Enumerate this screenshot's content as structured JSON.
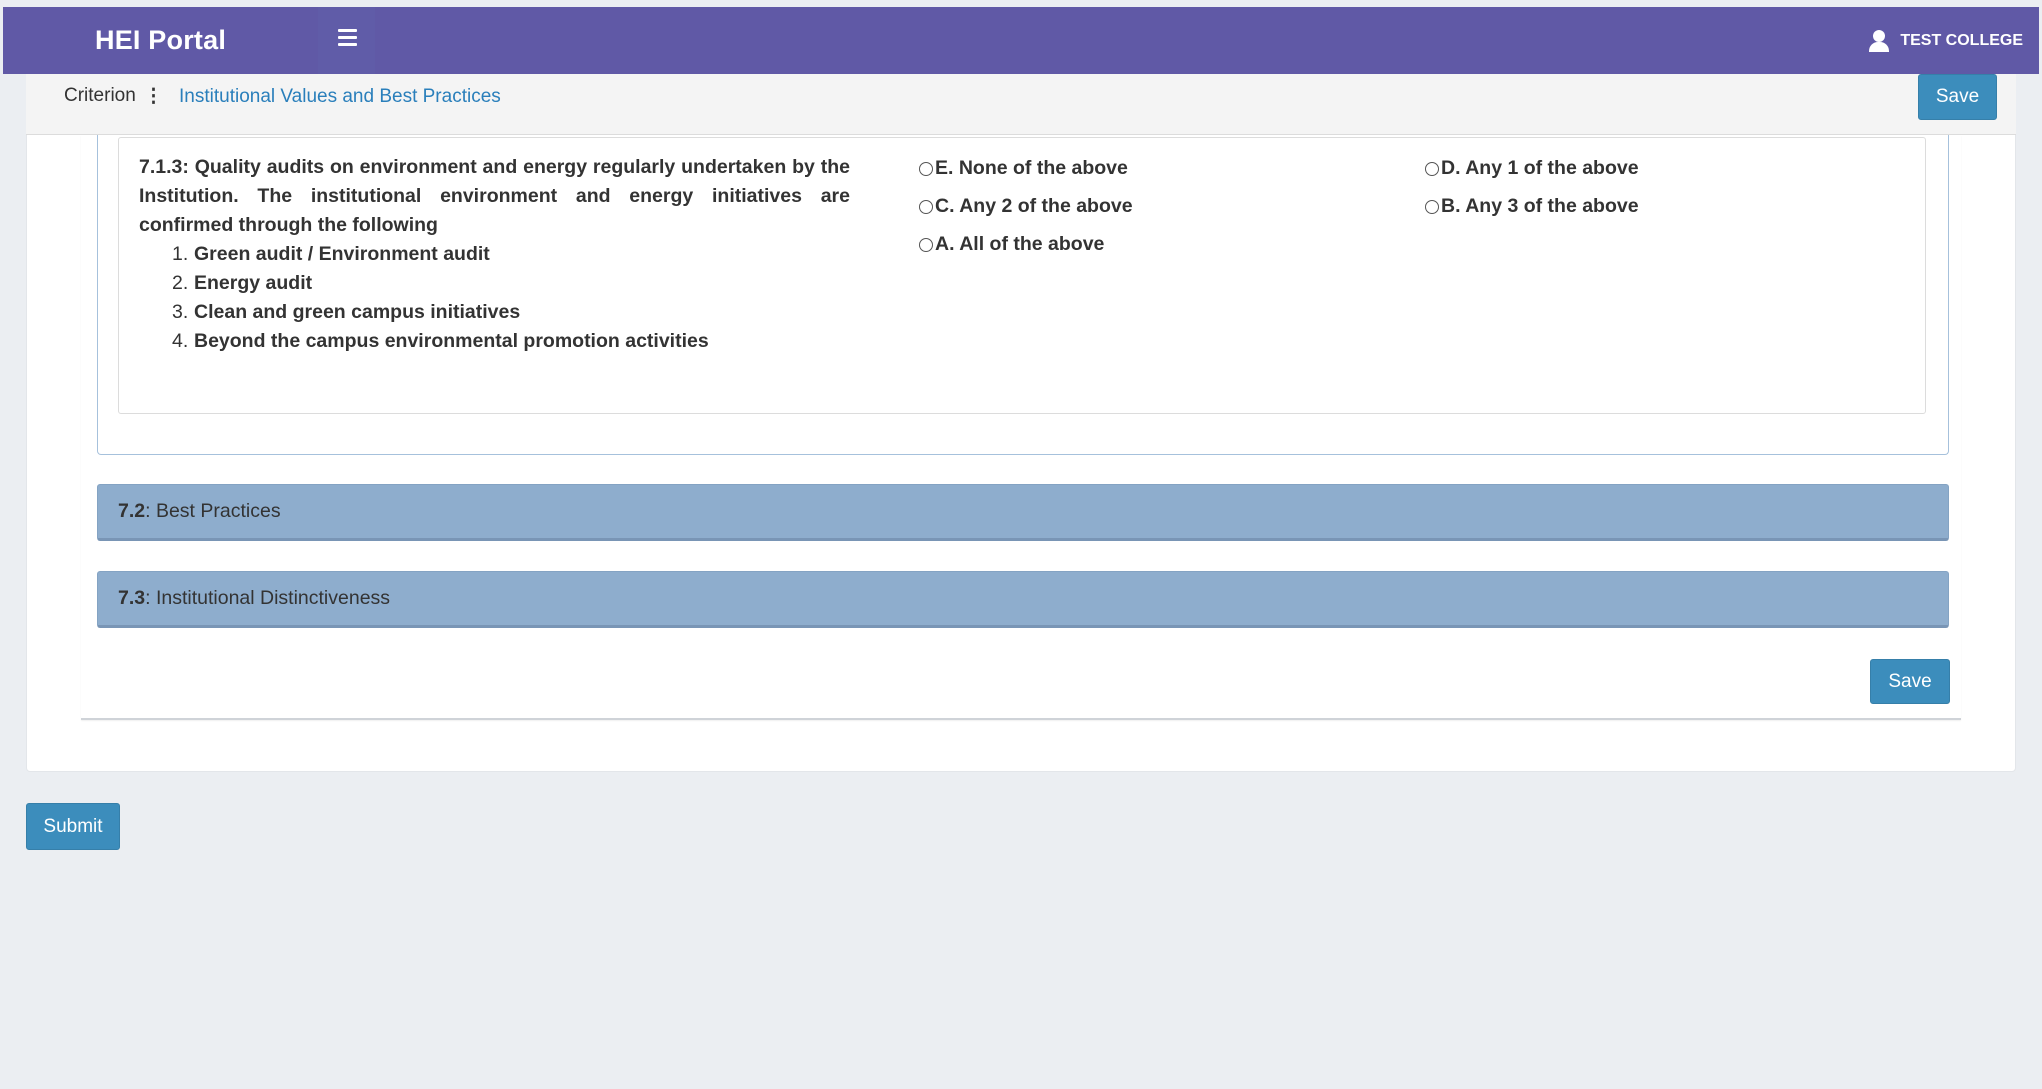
{
  "header": {
    "brand": "HEI Portal",
    "user_name": "TEST COLLEGE",
    "accent_color": "#6059a6"
  },
  "criterion_bar": {
    "label": "Criterion",
    "dots": "⋮",
    "title": "Institutional Values and Best Practices",
    "save_label": "Save"
  },
  "question": {
    "text": "7.1.3: Quality audits on environment and energy regularly undertaken by the Institution. The institutional environment and energy initiatives are confirmed through the following",
    "items": [
      {
        "num": "1.",
        "text": "Green audit / Environment audit"
      },
      {
        "num": "2.",
        "text": "Energy audit"
      },
      {
        "num": "3.",
        "text": "Clean and green campus initiatives"
      },
      {
        "num": "4.",
        "text": "Beyond the campus environmental promotion activities"
      }
    ],
    "options": [
      "E. None of the above",
      "C. Any 2 of the above",
      "A. All of the above",
      "D. Any 1 of the above",
      "B. Any 3 of the above"
    ]
  },
  "sections": [
    {
      "code": "7.2",
      "title": ": Best Practices"
    },
    {
      "code": "7.3",
      "title": ": Institutional Distinctiveness"
    }
  ],
  "footer": {
    "save_label": "Save",
    "submit_label": "Submit"
  },
  "icons": {
    "menu": "hamburger-icon",
    "user": "user-icon",
    "radio": "radio-icon"
  }
}
